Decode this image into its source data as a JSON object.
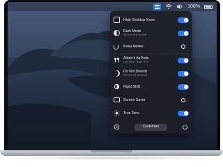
{
  "menubar": {
    "battery_text": "100%"
  },
  "panel": {
    "items": [
      {
        "label": "Hide Desktop Icons",
        "sub": "",
        "icon": "desktop-icon",
        "control": "toggle",
        "on": true
      },
      {
        "label": "Dark Mode",
        "sub": "Will set off at sunrise",
        "icon": "dark-mode-icon",
        "control": "toggle",
        "on": true
      },
      {
        "label": "Keep Awake",
        "sub": "",
        "icon": "coffee-cup-icon",
        "control": "radio",
        "on": false
      },
      {
        "label": "Albert’s AirPods",
        "sub": "Left: 88% • Right: 87%",
        "icon": "airpods-icon",
        "control": "toggle",
        "on": true
      },
      {
        "label": "Do Not Disturb",
        "sub": "Will turn off tomorrow",
        "icon": "moon-icon",
        "control": "toggle",
        "on": true
      },
      {
        "label": "Night Shift",
        "sub": "",
        "icon": "night-shift-icon",
        "control": "toggle",
        "on": true
      },
      {
        "label": "Screen Saver",
        "sub": "",
        "icon": "monitor-icon",
        "control": "radio",
        "on": false
      },
      {
        "label": "True Tone",
        "sub": "",
        "icon": "sun-icon",
        "control": "toggle",
        "on": true
      }
    ],
    "customize_label": "Customize"
  },
  "colors": {
    "accent": "#2d7cf6",
    "panel_bg": "#1c1f26",
    "wallpaper_sky": "#3a4a66"
  }
}
